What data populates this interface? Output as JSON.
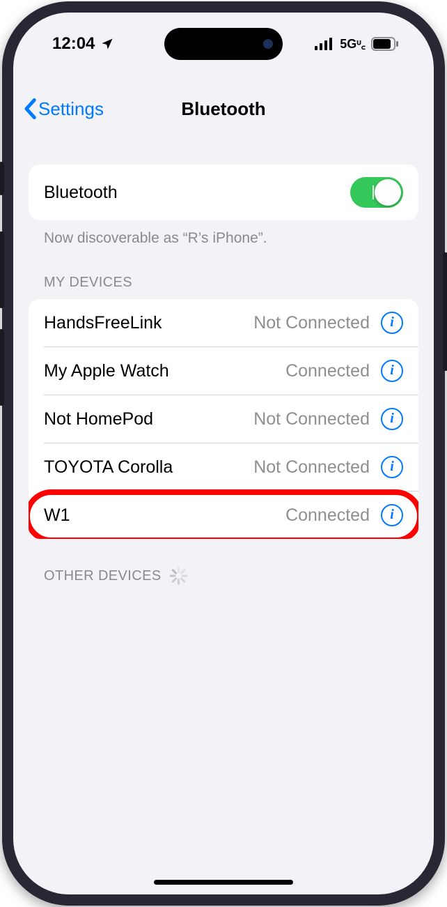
{
  "status": {
    "time": "12:04",
    "network": "5Gᶸ꜀"
  },
  "nav": {
    "back_label": "Settings",
    "title": "Bluetooth"
  },
  "bluetooth": {
    "label": "Bluetooth",
    "enabled": true,
    "footer": "Now discoverable as “R’s iPhone”."
  },
  "sections": {
    "my_devices_header": "MY DEVICES",
    "other_devices_header": "OTHER DEVICES"
  },
  "devices": [
    {
      "name": "HandsFreeLink",
      "status": "Not Connected",
      "highlighted": false
    },
    {
      "name": "My Apple Watch",
      "status": "Connected",
      "highlighted": false
    },
    {
      "name": "Not HomePod",
      "status": "Not Connected",
      "highlighted": false
    },
    {
      "name": "TOYOTA Corolla",
      "status": "Not Connected",
      "highlighted": false
    },
    {
      "name": "W1",
      "status": "Connected",
      "highlighted": true
    }
  ],
  "icons": {
    "info": "info-icon",
    "location": "location-arrow-icon",
    "signal": "cellular-signal-icon",
    "battery": "battery-icon",
    "chevron_left": "chevron-left-icon",
    "spinner": "activity-spinner-icon"
  }
}
